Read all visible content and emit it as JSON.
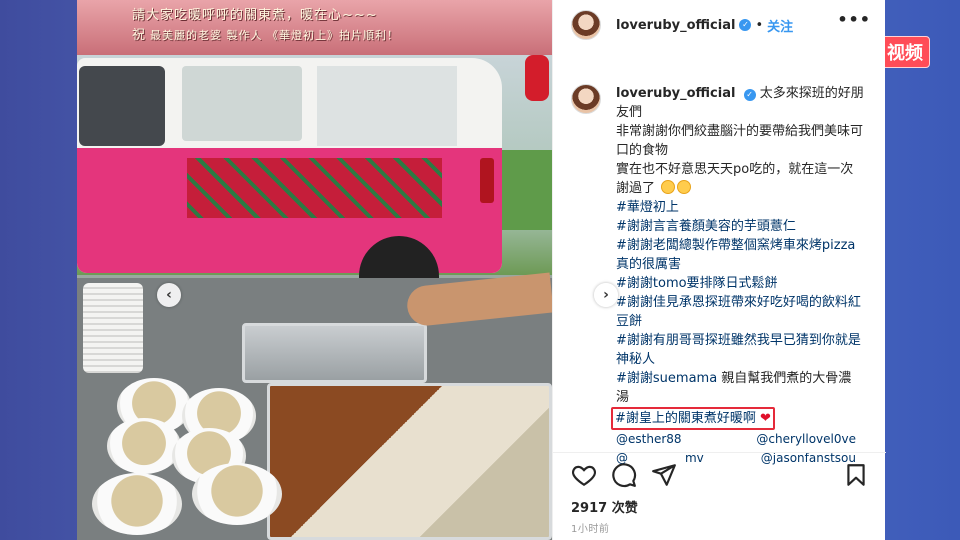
{
  "badge": "视频",
  "photo": {
    "banner_line1": "請大家吃暖呼呼的關東煮，暖在心~~~",
    "banner_prefix": "祝",
    "banner_line2": "最美麗的老婆 製作人 《華燈初上》拍片順利！",
    "prev": "‹",
    "next": "›"
  },
  "header": {
    "username": "loveruby_official",
    "dot": "•",
    "follow": "关注",
    "more": "•••"
  },
  "caption": {
    "username": "loveruby_official",
    "first_text": "太多來探班的好朋友們",
    "lines": [
      "非常謝謝你們絞盡腦汁的要帶給我們美味可口的食物",
      "實在也不好意思天天po吃的，就在這一次謝過了"
    ],
    "hashtags": [
      "#華燈初上",
      "#謝謝言言養顏美容的芋頭薏仁",
      "#謝謝老闆總製作帶整個窯烤車來烤pizza真的很厲害",
      "#謝謝tomo要排隊日式鬆餅",
      "#謝謝佳見承恩探班帶來好吃好喝的飲料紅豆餅",
      "#謝謝有朋哥哥探班雖然我早已猜到你就是神秘人"
    ],
    "suemama_tag": "#謝謝suemama",
    "suemama_text": " 親自幫我們煮的大骨濃湯",
    "highlight_tag": "#謝皇上的關東煮好暖啊",
    "heart": "❤",
    "mentions": [
      "@esther88",
      "@cheryllovel0ve",
      "@",
      "mv",
      "@jasonfanstsou"
    ]
  },
  "likes": "2917 次赞",
  "time": "1小时前",
  "colors": {
    "accent": "#3897f0",
    "highlight_border": "#e52a3a",
    "hashtag": "#003569",
    "badge_bg": "#ff4c57"
  },
  "icons": [
    "heart-outline-icon",
    "comment-icon",
    "share-icon",
    "bookmark-icon",
    "verified-icon",
    "more-icon"
  ]
}
